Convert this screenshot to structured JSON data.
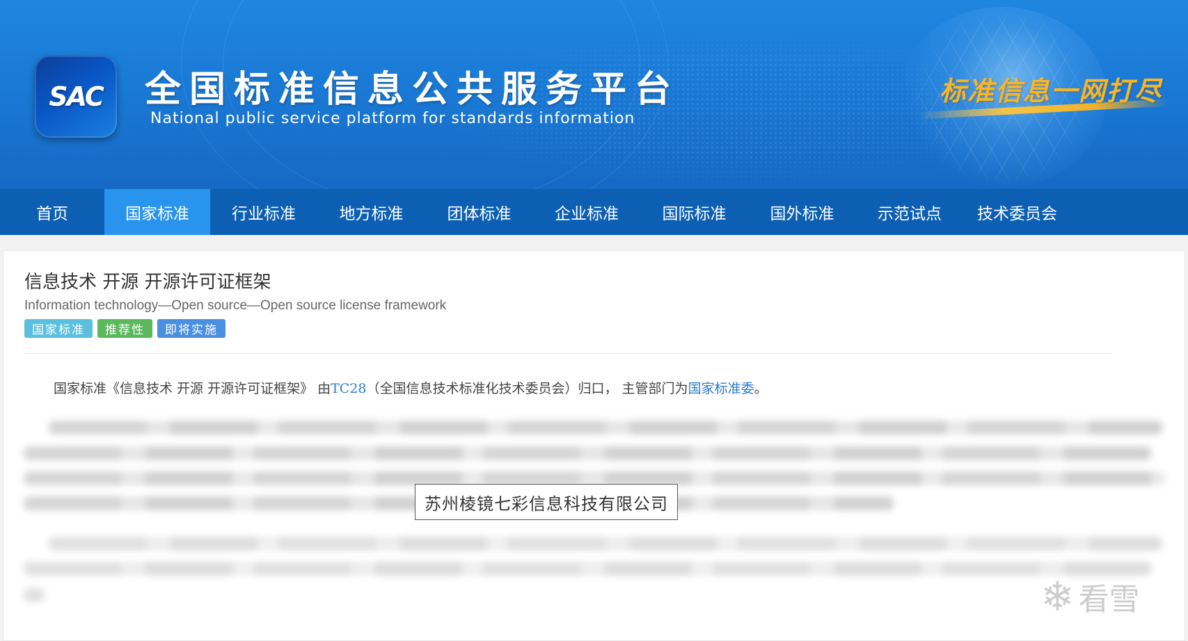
{
  "header": {
    "logo_text": "SAC",
    "title": "全国标准信息公共服务平台",
    "subtitle": "National public service platform  for standards information",
    "slogan": "标准信息一网打尽"
  },
  "nav": {
    "items": [
      {
        "label": "首页",
        "active": false
      },
      {
        "label": "国家标准",
        "active": true
      },
      {
        "label": "行业标准",
        "active": false
      },
      {
        "label": "地方标准",
        "active": false
      },
      {
        "label": "团体标准",
        "active": false
      },
      {
        "label": "企业标准",
        "active": false
      },
      {
        "label": "国际标准",
        "active": false
      },
      {
        "label": "国外标准",
        "active": false
      },
      {
        "label": "示范试点",
        "active": false
      },
      {
        "label": "技术委员会",
        "active": false
      }
    ]
  },
  "document": {
    "title_cn": "信息技术 开源 开源许可证框架",
    "title_en": "Information technology—Open source—Open source license framework",
    "tags": [
      {
        "label": "国家标准",
        "color": "#5bc0de"
      },
      {
        "label": "推荐性",
        "color": "#5cb85c"
      },
      {
        "label": "即将实施",
        "color": "#4a8fe0"
      }
    ],
    "summary": {
      "prefix": "国家标准《信息技术 开源 开源许可证框架》 由",
      "committee_link": "TC28",
      "middle": "（全国信息技术标准化技术委员会）归口， 主管部门为",
      "authority_link": "国家标准委",
      "suffix": "。"
    }
  },
  "overlay": {
    "company": "苏州棱镜七彩信息科技有限公司"
  },
  "watermark": {
    "icon": "snowflake-icon",
    "text": "看雪"
  },
  "colors": {
    "banner": "#1a7ad6",
    "nav_bg": "#0c5fb3",
    "nav_active": "#2894ee",
    "link": "#2b7bd1"
  }
}
